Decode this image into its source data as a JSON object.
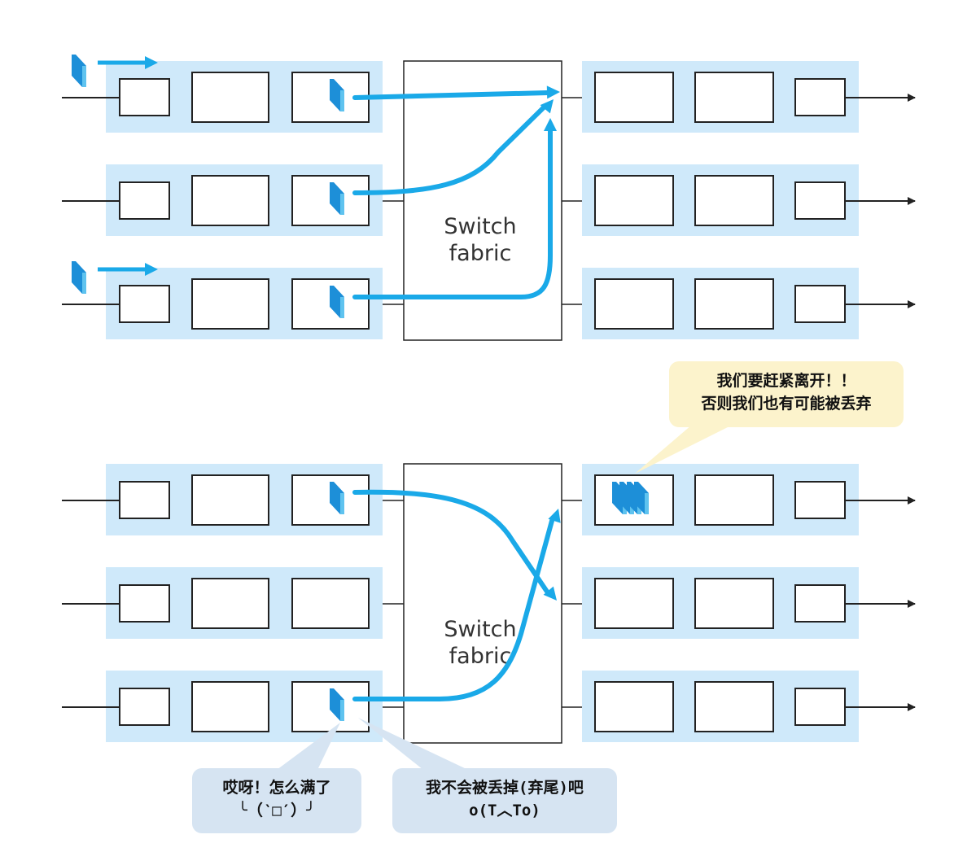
{
  "colors": {
    "port_bg": "#cfe9fa",
    "arrow_blue": "#1aa9e8",
    "packet_blue": "#1d8fd8",
    "line": "#222222",
    "bubble_yellow": "#fcf3cc",
    "bubble_blue": "#d6e4f2"
  },
  "panels": [
    {
      "id": "top",
      "fabric_label_line1": "Switch",
      "fabric_label_line2": "fabric",
      "incoming_packets_rows": [
        0,
        2
      ],
      "head_packet_rows": [
        0,
        1,
        2
      ],
      "output_queue_packets": 0
    },
    {
      "id": "bottom",
      "fabric_label_line1": "Switch",
      "fabric_label_line2": "fabric",
      "incoming_packets_rows": [],
      "head_packet_rows": [
        0,
        2
      ],
      "output_queue_packets": 4
    }
  ],
  "bubbles": {
    "top": {
      "line1": "我们要赶紧离开！！",
      "line2": "否则我们也有可能被丢弃"
    },
    "left": {
      "line1": "哎呀！怎么满了",
      "line2": "╰（‵□′）╯"
    },
    "right": {
      "line1": "我不会被丢掉(弃尾)吧",
      "line2": "o(T︿To)"
    }
  }
}
